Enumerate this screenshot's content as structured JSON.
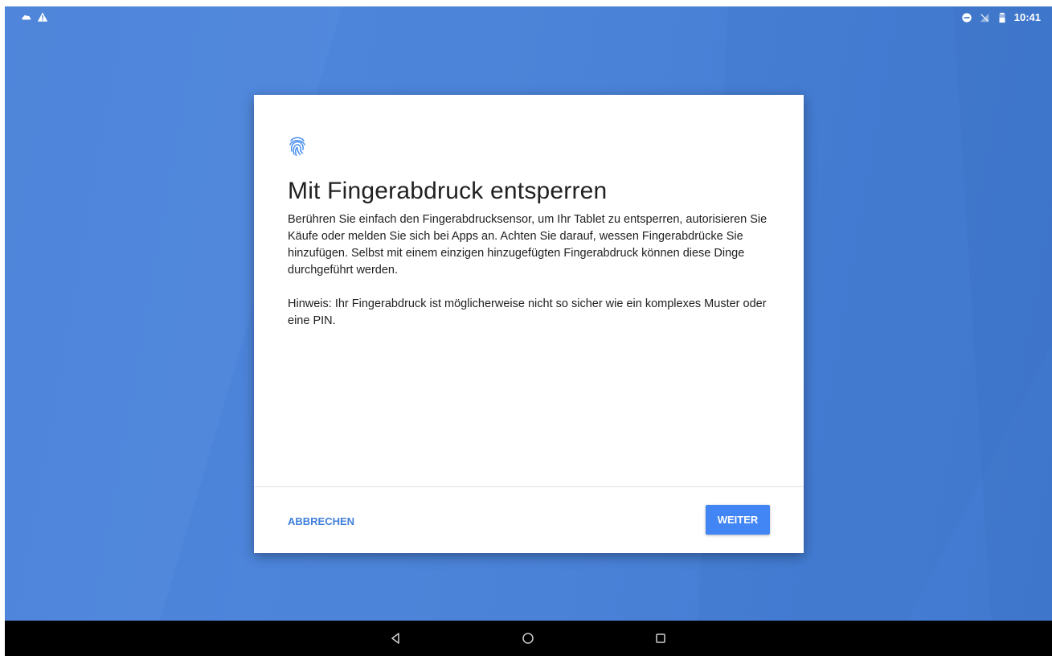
{
  "status_bar": {
    "left_icons": [
      "cloud-icon",
      "warning-icon"
    ],
    "right_icons": [
      "do-not-disturb-icon",
      "no-signal-icon",
      "battery-icon"
    ],
    "time": "10:41"
  },
  "dialog": {
    "icon": "fingerprint-icon",
    "title": "Mit Fingerabdruck entsperren",
    "body_paragraph_1": "Berühren Sie einfach den Fingerabdrucksensor, um Ihr Tablet zu entsperren, autorisieren Sie Käufe oder melden Sie sich bei Apps an. Achten Sie darauf, wessen Fingerabdrücke Sie hinzufügen. Selbst mit einem einzigen hinzugefügten Fingerabdruck können diese Dinge durchgeführt werden.",
    "body_paragraph_2": "Hinweis: Ihr Fingerabdruck ist möglicherweise nicht so sicher wie ein komplexes Muster oder eine PIN.",
    "cancel_label": "ABBRECHEN",
    "next_label": "WEITER"
  },
  "nav_bar": {
    "buttons": [
      "back-icon",
      "home-icon",
      "recents-icon"
    ]
  },
  "colors": {
    "background": "#4a82d8",
    "accent": "#4285f4",
    "link": "#3f7fdb",
    "nav_bar": "#000000"
  }
}
